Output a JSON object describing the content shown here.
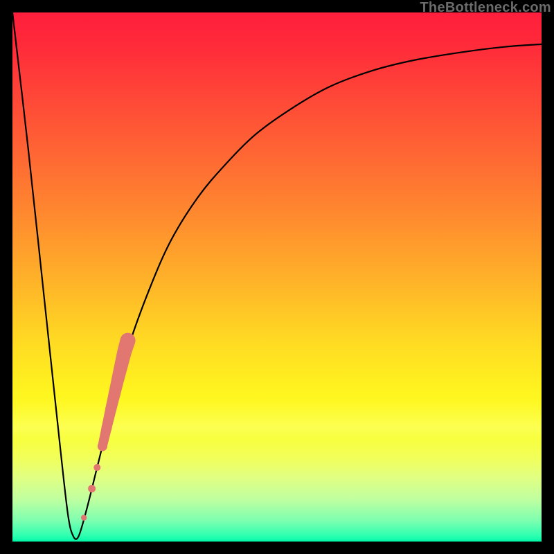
{
  "watermark": "TheBottleneck.com",
  "colors": {
    "curve": "#000000",
    "dots": "#e27670",
    "frame": "#000000"
  },
  "chart_data": {
    "type": "line",
    "title": "",
    "xlabel": "",
    "ylabel": "",
    "xlim": [
      0,
      100
    ],
    "ylim": [
      0,
      100
    ],
    "series": [
      {
        "name": "bottleneck-curve",
        "x": [
          0,
          3,
          6,
          9,
          10.5,
          11.5,
          12.5,
          14,
          16,
          19,
          22,
          26,
          30,
          35,
          40,
          46,
          53,
          60,
          68,
          76,
          85,
          93,
          100
        ],
        "y": [
          100,
          74,
          46,
          18,
          5,
          1,
          1,
          6,
          14,
          26,
          37,
          48,
          57,
          65,
          71,
          77,
          82,
          86,
          89,
          91,
          92.5,
          93.5,
          94
        ]
      },
      {
        "name": "highlight-dots",
        "x": [
          13.5,
          15.0,
          16.0,
          17.0,
          17.8,
          18.6,
          19.3,
          20.0,
          20.6,
          21.2,
          21.8
        ],
        "y": [
          4.5,
          10.0,
          14.0,
          18.0,
          21.5,
          25.0,
          28.0,
          31.0,
          33.5,
          36.0,
          38.0
        ]
      }
    ]
  }
}
